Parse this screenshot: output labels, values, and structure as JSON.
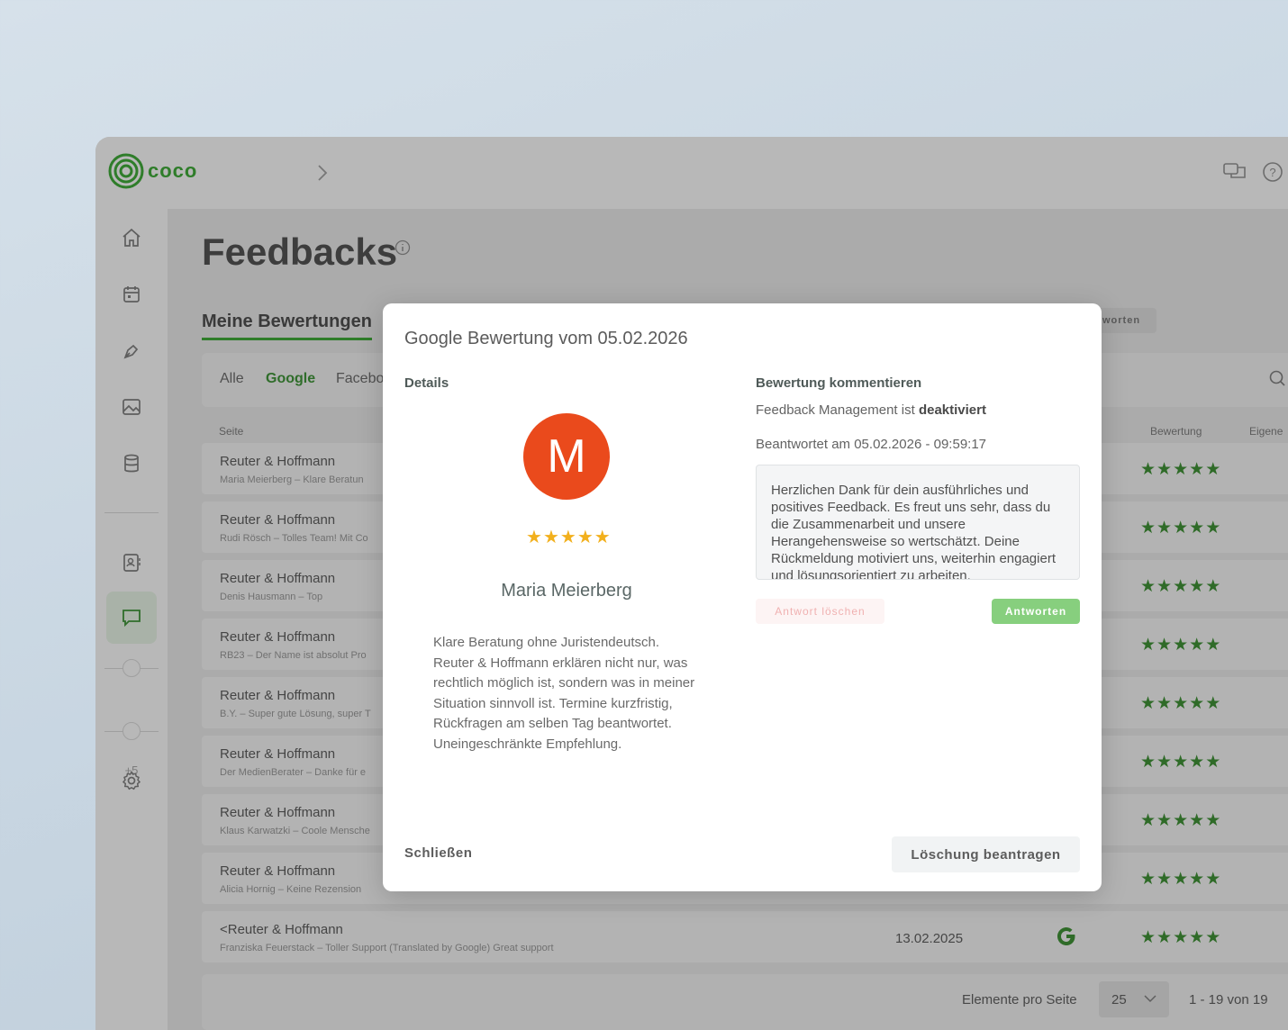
{
  "app": {
    "logo_text": "coco"
  },
  "page": {
    "title": "Feedbacks"
  },
  "tabs": {
    "main": "Meine Bewertungen",
    "right_button": "worten"
  },
  "filters": [
    "Alle",
    "Google",
    "Facebo"
  ],
  "columns": {
    "seite": "Seite",
    "bewertung": "Bewertung",
    "eigene": "Eigene"
  },
  "sidebar": {
    "extra_count": "+5"
  },
  "rows": [
    {
      "title": "Reuter & Hoffmann",
      "sub": "Maria Meierberg – Klare Beratun",
      "date": "",
      "stars": "★★★★★"
    },
    {
      "title": "Reuter & Hoffmann",
      "sub": "Rudi Rösch – Tolles Team! Mit Co",
      "date": "",
      "stars": "★★★★★"
    },
    {
      "title": "Reuter & Hoffmann",
      "sub": "Denis Hausmann – Top",
      "date": "",
      "stars": "★★★★★"
    },
    {
      "title": "Reuter & Hoffmann",
      "sub": "RB23 – Der Name ist absolut Pro",
      "date": "",
      "stars": "★★★★★"
    },
    {
      "title": "Reuter & Hoffmann",
      "sub": "B.Y. – Super gute Lösung, super T",
      "date": "",
      "stars": "★★★★★"
    },
    {
      "title": "Reuter & Hoffmann",
      "sub": "Der MedienBerater – Danke für e",
      "date": "",
      "stars": "★★★★★"
    },
    {
      "title": "Reuter & Hoffmann",
      "sub": "Klaus Karwatzki – Coole Mensche",
      "date": "",
      "stars": "★★★★★"
    },
    {
      "title": "Reuter & Hoffmann",
      "sub": "Alicia Hornig – Keine Rezension",
      "date": "",
      "stars": "★★★★★"
    },
    {
      "title": "<Reuter & Hoffmann",
      "sub": "Franziska Feuerstack – Toller Support (Translated by Google) Great support",
      "date": "13.02.2025",
      "stars": "★★★★★"
    }
  ],
  "pager": {
    "label": "Elemente pro Seite",
    "per_page": "25",
    "range": "1 - 19 von 19"
  },
  "modal": {
    "title": "Google Bewertung vom 05.02.2026",
    "details_label": "Details",
    "avatar_letter": "M",
    "stars": "★★★★★",
    "reviewer": "Maria Meierberg",
    "review_text": "Klare Beratung ohne Juristendeutsch. Reuter & Hoffmann erklären nicht nur, was rechtlich möglich ist, sondern was in meiner Situation sinnvoll ist. Termine kurzfristig, Rückfragen am selben Tag beantwortet. Uneingeschränkte Empfehlung.",
    "comment_label": "Bewertung kommentieren",
    "fm_prefix": "Feedback Management ist ",
    "fm_state": "deaktiviert",
    "answered": "Beantwortet am 05.02.2026 - 09:59:17",
    "reply": "Herzlichen Dank für dein ausführliches und positives Feedback. Es freut uns sehr, dass du die Zusammenarbeit und unsere Herangehensweise so wertschätzt. Deine Rückmeldung motiviert uns, weiterhin engagiert und lösungsorientiert zu arbeiten.",
    "delete_answer_label": "Antwort löschen",
    "answer_label": "Antworten",
    "close_label": "Schließen",
    "request_delete_label": "Löschung beantragen"
  },
  "colors": {
    "brand": "#2f7d2a",
    "avatar": "#ea4a1c",
    "star_modal": "#f2b01d",
    "answer_button": "#87cf7e"
  }
}
